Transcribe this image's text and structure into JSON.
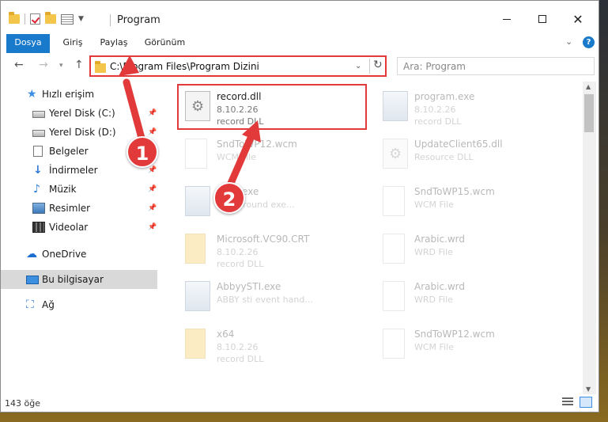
{
  "window": {
    "title": "Program"
  },
  "ribbon": {
    "tabs": [
      "Dosya",
      "Giriş",
      "Paylaş",
      "Görünüm"
    ]
  },
  "address": {
    "path": "C:\\Program Files\\Program Dizini",
    "search_placeholder": "Ara: Program"
  },
  "sidebar": {
    "items": [
      {
        "label": "Hızlı erişim",
        "icon": "star-icon"
      },
      {
        "label": "Yerel Disk (C:)",
        "icon": "disk-icon"
      },
      {
        "label": "Yerel Disk (D:)",
        "icon": "disk-icon"
      },
      {
        "label": "Belgeler",
        "icon": "documents-icon"
      },
      {
        "label": "İndirmeler",
        "icon": "download-icon"
      },
      {
        "label": "Müzik",
        "icon": "music-icon"
      },
      {
        "label": "Resimler",
        "icon": "pictures-icon"
      },
      {
        "label": "Videolar",
        "icon": "videos-icon"
      },
      {
        "label": "OneDrive",
        "icon": "cloud-icon"
      },
      {
        "label": "Bu bilgisayar",
        "icon": "computer-icon"
      },
      {
        "label": "Ağ",
        "icon": "network-icon"
      }
    ]
  },
  "files": [
    {
      "name": "record.dll",
      "line2": "8.10.2.26",
      "line3": "record DLL",
      "type": "dll"
    },
    {
      "name": "program.exe",
      "line2": "8.10.2.26",
      "line3": "record DLL",
      "type": "exe"
    },
    {
      "name": "SndToWP12.wcm",
      "line2": "WCM File",
      "line3": "",
      "type": "blank"
    },
    {
      "name": "UpdateClient65.dll",
      "line2": "Resource DLL",
      "line3": "",
      "type": "dll"
    },
    {
      "name": "Exec.exe",
      "line2": "background exe...",
      "line3": "",
      "type": "exe"
    },
    {
      "name": "SndToWP15.wcm",
      "line2": "WCM File",
      "line3": "",
      "type": "blank"
    },
    {
      "name": "Microsoft.VC90.CRT",
      "line2": "8.10.2.26",
      "line3": "record DLL",
      "type": "folder"
    },
    {
      "name": "Arabic.wrd",
      "line2": "WRD File",
      "line3": "",
      "type": "blank"
    },
    {
      "name": "AbbyySTI.exe",
      "line2": "ABBY sti event hand...",
      "line3": "",
      "type": "exe"
    },
    {
      "name": "Arabic.wrd",
      "line2": "WRD File",
      "line3": "",
      "type": "blank"
    },
    {
      "name": "x64",
      "line2": "8.10.2.26",
      "line3": "record DLL",
      "type": "folder"
    },
    {
      "name": "SndToWP12.wcm",
      "line2": "WCM File",
      "line3": "",
      "type": "blank"
    }
  ],
  "status": {
    "count": "143 öğe"
  },
  "callouts": [
    "1",
    "2"
  ]
}
